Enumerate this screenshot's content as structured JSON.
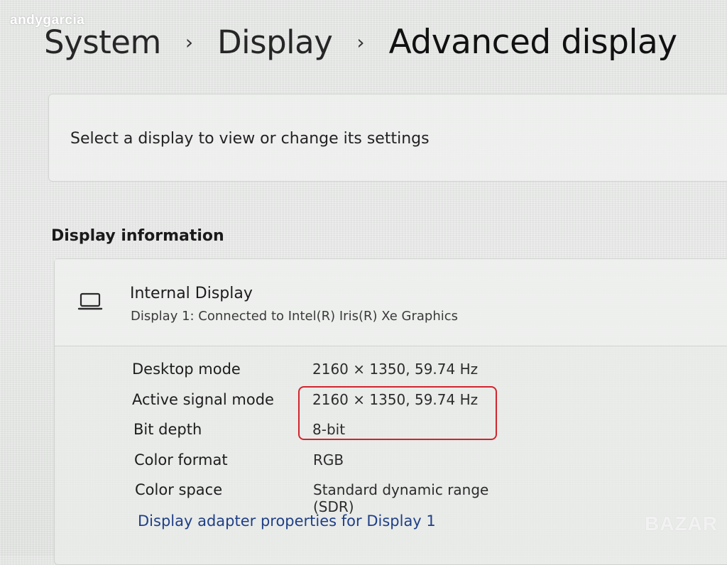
{
  "watermark": "andygarcia",
  "breadcrumb": {
    "items": [
      "System",
      "Display",
      "Advanced display"
    ]
  },
  "select_display": {
    "label": "Select a display to view or change its settings"
  },
  "display_information": {
    "section_title": "Display information",
    "display_name": "Internal Display",
    "display_subtitle": "Display 1: Connected to Intel(R) Iris(R) Xe Graphics",
    "rows": [
      {
        "label": "Desktop mode",
        "value": "2160 × 1350, 59.74 Hz"
      },
      {
        "label": "Active signal mode",
        "value": "2160 × 1350, 59.74 Hz"
      },
      {
        "label": "Bit depth",
        "value": "8-bit"
      },
      {
        "label": "Color format",
        "value": "RGB"
      },
      {
        "label": "Color space",
        "value": "Standard dynamic range (SDR)"
      }
    ],
    "adapter_link": "Display adapter properties for Display 1"
  },
  "logo": "BAZAR",
  "colors": {
    "link": "#1f3f86",
    "highlight": "#d2242c"
  },
  "icons": {
    "display": "laptop-icon",
    "separator": "chevron-right-icon"
  }
}
